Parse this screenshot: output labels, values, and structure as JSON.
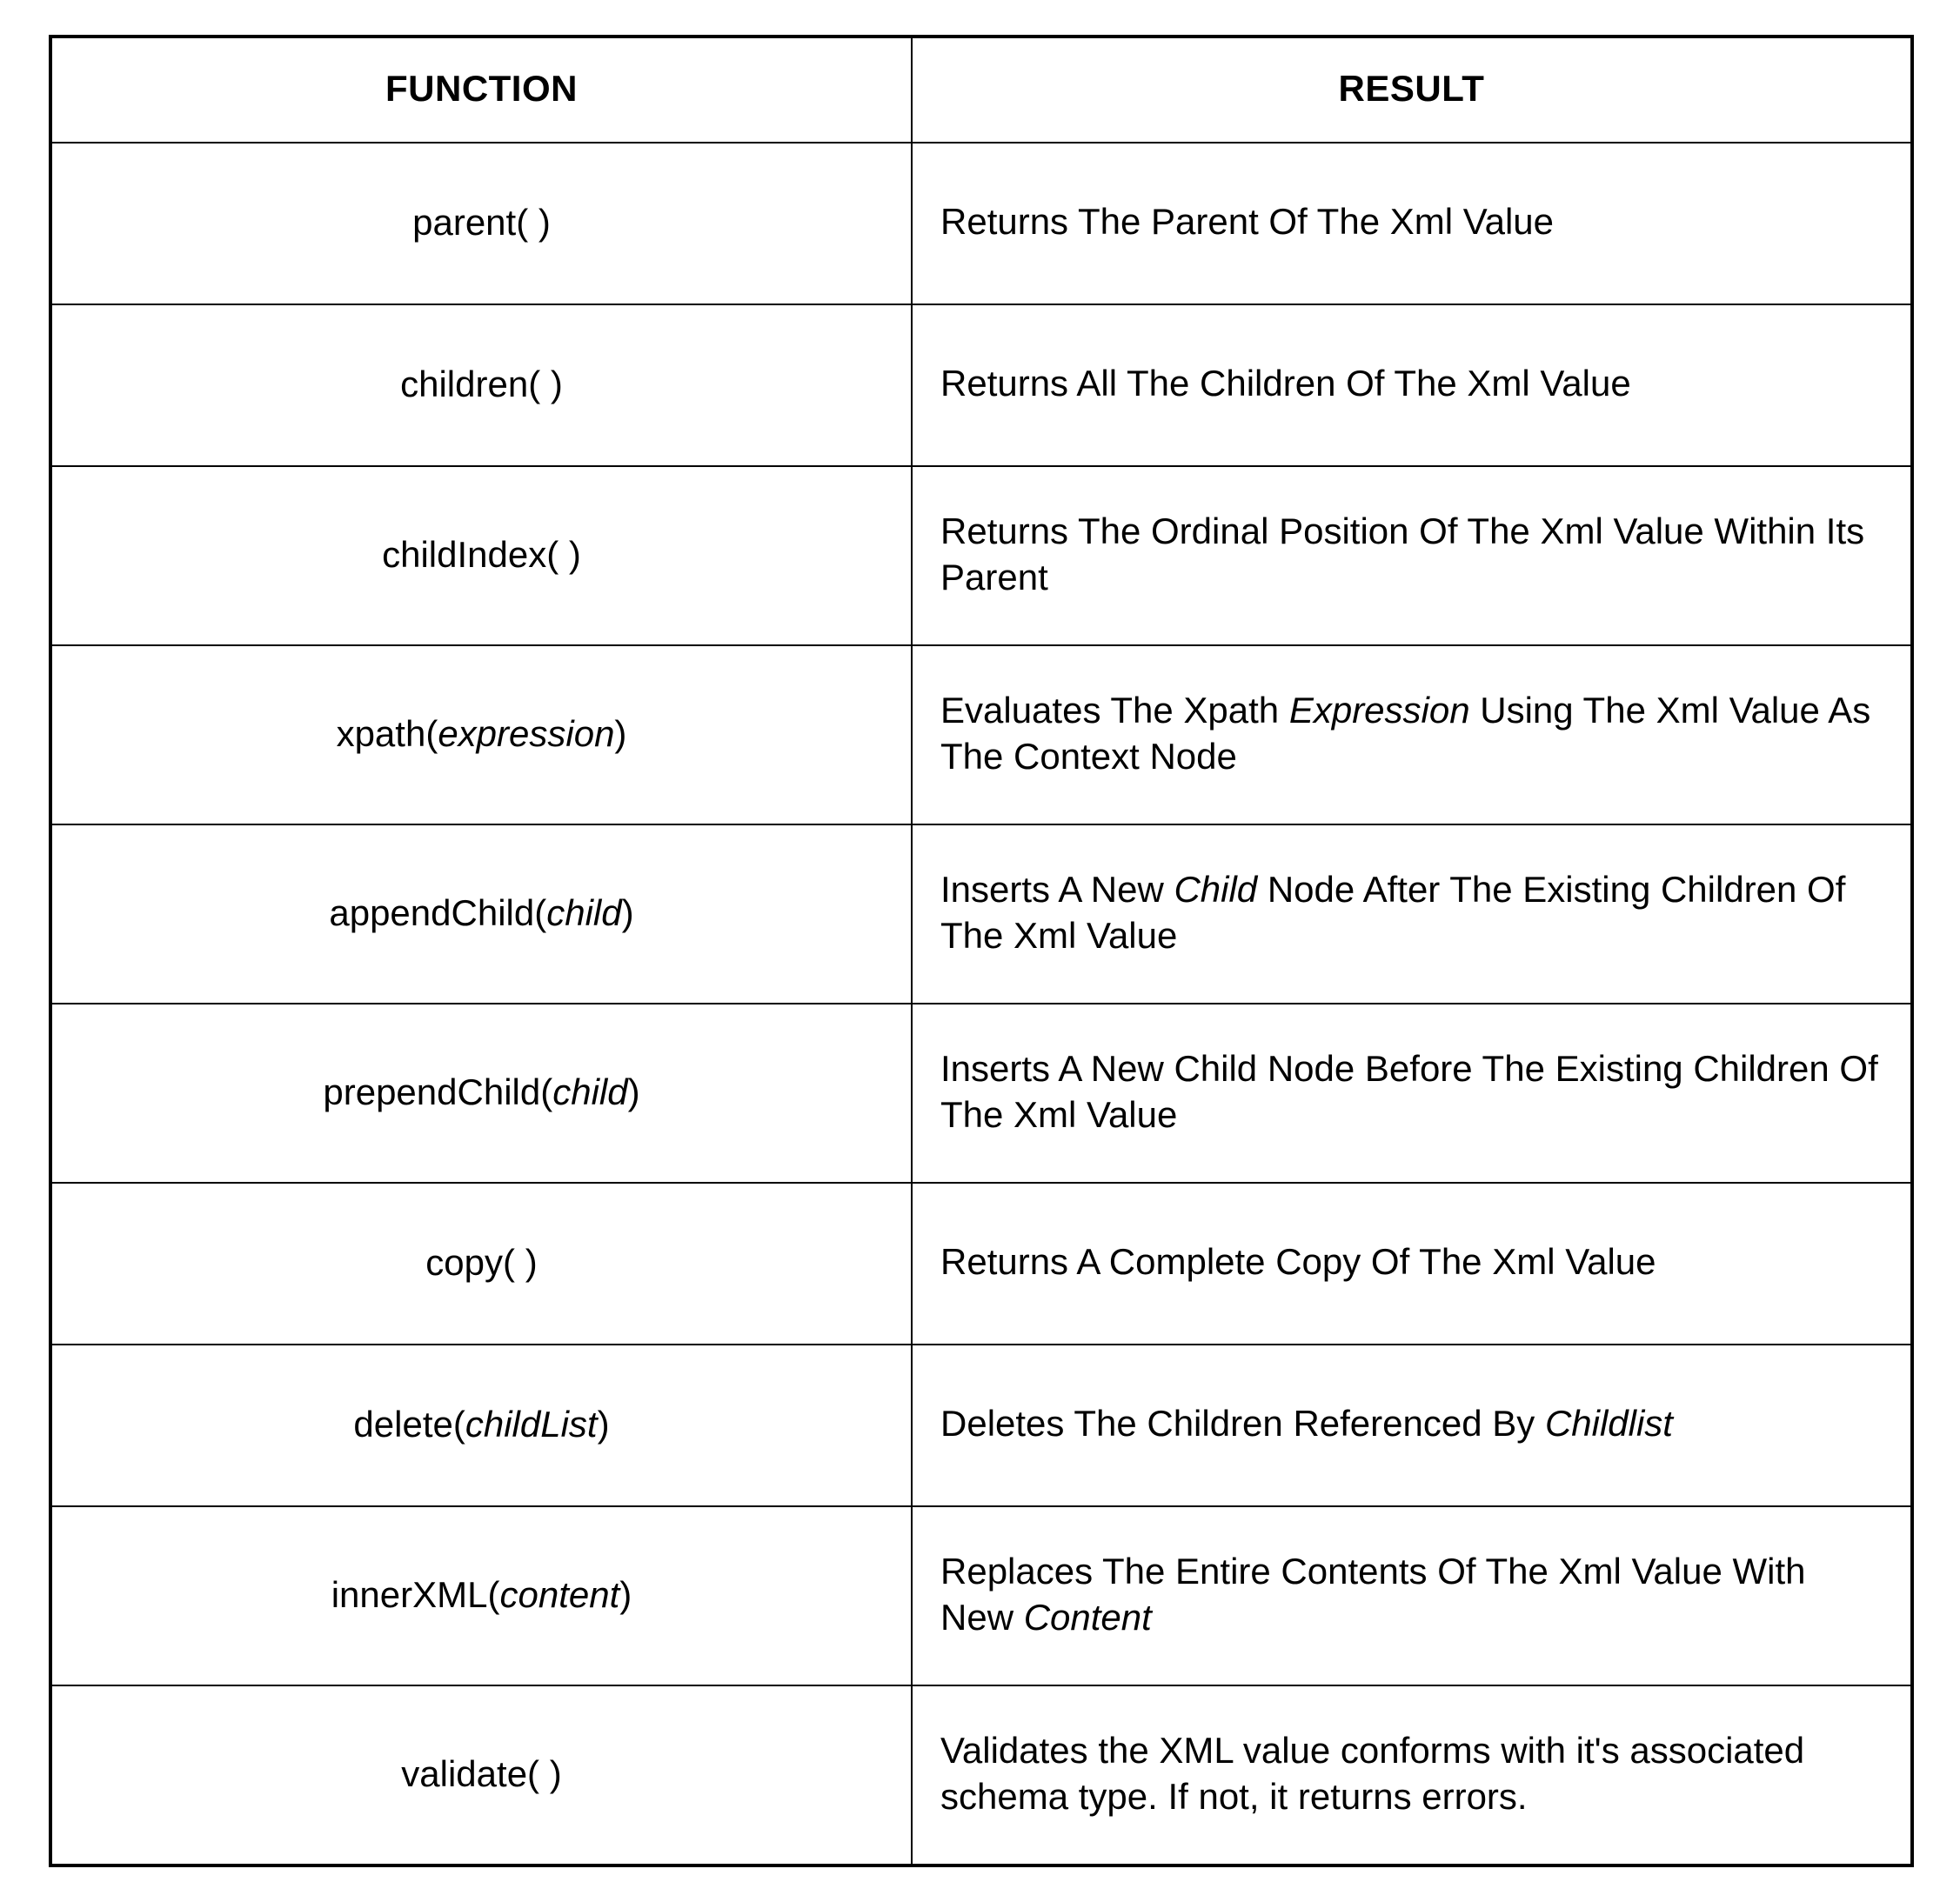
{
  "headers": {
    "function": "FUNCTION",
    "result": "RESULT"
  },
  "rows": [
    {
      "fn": {
        "name": "parent",
        "open": "(",
        "arg": "",
        "close": ")",
        "pad_arg": true
      },
      "res": [
        {
          "t": "Returns The Parent Of The Xml Value",
          "i": false
        }
      ],
      "cls": "h1"
    },
    {
      "fn": {
        "name": "children",
        "open": "(",
        "arg": "",
        "close": ")",
        "pad_arg": true
      },
      "res": [
        {
          "t": "Returns All The Children Of The Xml Value",
          "i": false
        }
      ],
      "cls": "h1"
    },
    {
      "fn": {
        "name": "childIndex",
        "open": "(",
        "arg": "",
        "close": ")",
        "pad_arg": true
      },
      "res": [
        {
          "t": "Returns The Ordinal Position Of The Xml Value Within Its Parent",
          "i": false
        }
      ],
      "cls": "h2"
    },
    {
      "fn": {
        "name": "xpath",
        "open": "(",
        "arg": "expression",
        "close": ")",
        "pad_arg": false
      },
      "res": [
        {
          "t": "Evaluates The Xpath ",
          "i": false
        },
        {
          "t": "Expression",
          "i": true
        },
        {
          "t": " Using The Xml Value As The Context Node",
          "i": false
        }
      ],
      "cls": "h2"
    },
    {
      "fn": {
        "name": "appendChild",
        "open": "(",
        "arg": "child",
        "close": ")",
        "pad_arg": false
      },
      "res": [
        {
          "t": "Inserts A New ",
          "i": false
        },
        {
          "t": "Child",
          "i": true
        },
        {
          "t": " Node After The Existing Children Of The Xml Value",
          "i": false
        }
      ],
      "cls": "h2"
    },
    {
      "fn": {
        "name": "prependChild",
        "open": "(",
        "arg": "child",
        "close": ")",
        "pad_arg": false
      },
      "res": [
        {
          "t": "Inserts A New Child Node Before The Existing Children Of The Xml Value",
          "i": false
        }
      ],
      "cls": "h2"
    },
    {
      "fn": {
        "name": "copy",
        "open": "(",
        "arg": "",
        "close": ")",
        "pad_arg": true
      },
      "res": [
        {
          "t": "Returns A Complete Copy Of The Xml Value",
          "i": false
        }
      ],
      "cls": "h1"
    },
    {
      "fn": {
        "name": "delete",
        "open": "(",
        "arg": "childList",
        "close": ")",
        "pad_arg": false
      },
      "res": [
        {
          "t": "Deletes The Children Referenced By ",
          "i": false
        },
        {
          "t": "Childlist",
          "i": true
        }
      ],
      "cls": "h1"
    },
    {
      "fn": {
        "name": "innerXML",
        "open": "(",
        "arg": "content",
        "close": ")",
        "pad_arg": false
      },
      "res": [
        {
          "t": "Replaces The Entire Contents Of The Xml Value With New ",
          "i": false
        },
        {
          "t": "Content",
          "i": true
        }
      ],
      "cls": "h2"
    },
    {
      "fn": {
        "name": "validate",
        "open": "(",
        "arg": "",
        "close": ")",
        "pad_arg": true
      },
      "res": [
        {
          "t": "Validates the XML value conforms with it's associated schema type. If not, it returns errors.",
          "i": false
        }
      ],
      "cls": "h2"
    }
  ]
}
